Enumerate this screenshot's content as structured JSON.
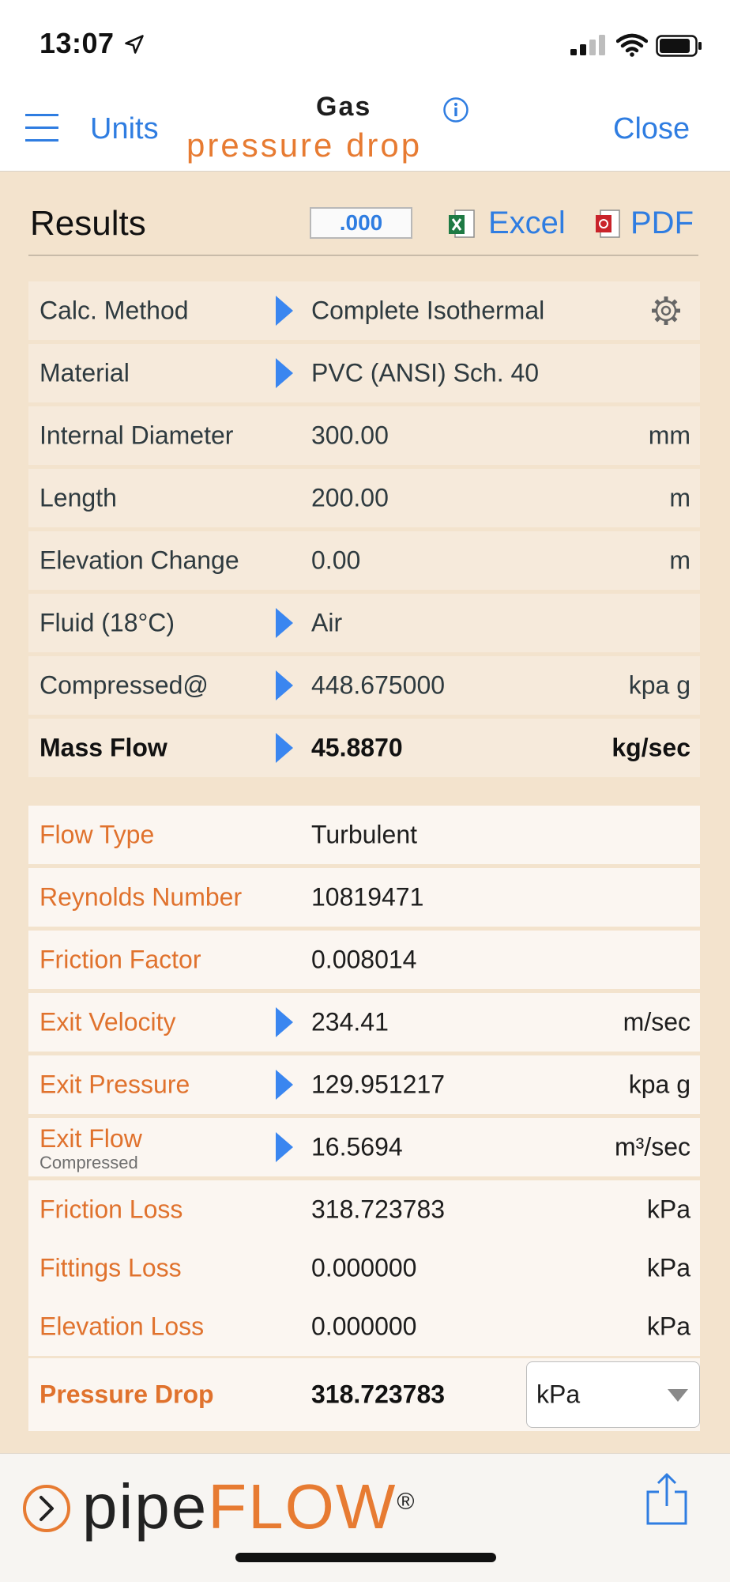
{
  "status": {
    "time": "13:07"
  },
  "nav": {
    "units_label": "Units",
    "close_label": "Close",
    "logo_top": "Gas",
    "logo_bottom": "pressure drop"
  },
  "results": {
    "title": "Results",
    "decimals_label": ".000",
    "excel_label": "Excel",
    "pdf_label": "PDF"
  },
  "inputs": [
    {
      "label": "Calc. Method",
      "value": "Complete Isothermal",
      "unit": ""
    },
    {
      "label": "Material",
      "value": "PVC (ANSI) Sch. 40",
      "unit": ""
    },
    {
      "label": "Internal Diameter",
      "value": "300.00",
      "unit": "mm"
    },
    {
      "label": "Length",
      "value": "200.00",
      "unit": "m"
    },
    {
      "label": "Elevation Change",
      "value": "0.00",
      "unit": "m"
    },
    {
      "label": "Fluid (18°C)",
      "value": "Air",
      "unit": ""
    },
    {
      "label": "Compressed@",
      "value": "448.675000",
      "unit": "kpa g"
    },
    {
      "label": "Mass Flow",
      "value": "45.8870",
      "unit": "kg/sec"
    }
  ],
  "outputs": [
    {
      "label": "Flow Type",
      "value": "Turbulent",
      "unit": ""
    },
    {
      "label": "Reynolds Number",
      "value": "10819471",
      "unit": ""
    },
    {
      "label": "Friction Factor",
      "value": "0.008014",
      "unit": ""
    },
    {
      "label": "Exit Velocity",
      "value": "234.41",
      "unit": "m/sec"
    },
    {
      "label": "Exit Pressure",
      "value": "129.951217",
      "unit": "kpa g"
    },
    {
      "label": "Exit Flow",
      "sublabel": "Compressed",
      "value": "16.5694",
      "unit": "m³/sec"
    },
    {
      "label": "Friction Loss",
      "value": "318.723783",
      "unit": "kPa"
    },
    {
      "label": "Fittings Loss",
      "value": "0.000000",
      "unit": "kPa"
    },
    {
      "label": "Elevation Loss",
      "value": "0.000000",
      "unit": "kPa"
    }
  ],
  "pressure_drop": {
    "label": "Pressure Drop",
    "value": "318.723783",
    "unit_selected": "kPa"
  },
  "footer": {
    "brand_a": "pipe",
    "brand_b": "FLOW",
    "registered": "®"
  },
  "colors": {
    "accent_blue": "#2f7de1",
    "brand_orange": "#e77b32",
    "background": "#f3e3cd"
  }
}
